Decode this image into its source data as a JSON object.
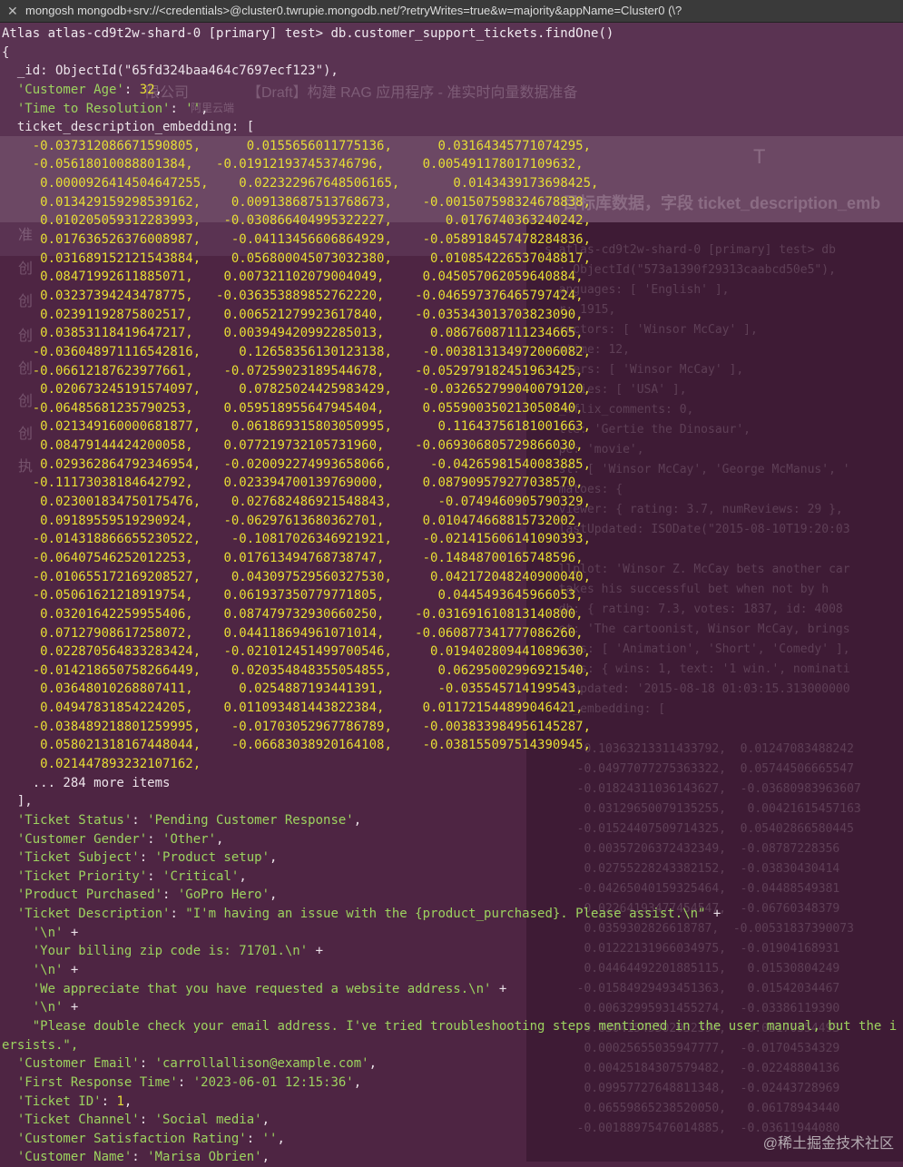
{
  "window": {
    "title": "mongosh mongodb+srv://<credentials>@cluster0.twrupie.mongodb.net/?retryWrites=true&w=majority&appName=Cluster0 (\\?"
  },
  "terminal": {
    "prompt": "Atlas atlas-cd9t2w-shard-0 [primary] test> ",
    "command": "db.customer_support_tickets.findOne()",
    "id_line": "  _id: ObjectId(\"65fd324baa464c7697ecf123\"),",
    "fields_top": [
      {
        "key": "'Customer Age'",
        "value": "32",
        "type": "n"
      },
      {
        "key": "'Time to Resolution'",
        "value": "''",
        "type": "s"
      }
    ],
    "embedding_key": "ticket_description_embedding",
    "embedding_rows": [
      [
        "-0.037312086671590805,",
        "0.0155656011775136,",
        "0.03164345771074295,"
      ],
      [
        "-0.05618010088801384,",
        "-0.019121937453746796,",
        "0.005491178017109632,"
      ],
      [
        "0.0000926414504647255,",
        "0.022322967648506165,",
        "0.0143439173698425,"
      ],
      [
        "0.013429159298539162,",
        "0.009138687513768673,",
        "-0.001507598324678838,"
      ],
      [
        "0.010205059312283993,",
        "-0.030866404995322227,",
        "0.0176740363240242,"
      ],
      [
        "0.017636526376008987,",
        "-0.04113456606864929,",
        "-0.058918457478284836,"
      ],
      [
        "0.031689152121543884,",
        "0.056800045073032380,",
        "0.010854226537048817,"
      ],
      [
        "0.08471992611885071,",
        "0.007321102079004049,",
        "0.045057062059640884,"
      ],
      [
        "0.03237394243478775,",
        "-0.036353889852762220,",
        "-0.046597376465797424,"
      ],
      [
        "0.02391192875802517,",
        "0.006521279923617840,",
        "-0.035343013703823090,"
      ],
      [
        "0.03853118419647217,",
        "0.003949420992285013,",
        "0.08676087111234665,"
      ],
      [
        "-0.036048971116542816,",
        "0.12658356130123138,",
        "-0.003813134972006082,"
      ],
      [
        "-0.06612187623977661,",
        "-0.07259023189544678,",
        "-0.052979182451963425,"
      ],
      [
        "0.020673245191574097,",
        "0.07825024425983429,",
        "-0.032652799040079120,"
      ],
      [
        "-0.06485681235790253,",
        "0.059518955647945404,",
        "0.055900350213050840,"
      ],
      [
        "0.021349160000681877,",
        "0.061869315803050995,",
        "0.11643756181001663,"
      ],
      [
        "0.08479144424200058,",
        "0.077219732105731960,",
        "-0.069306805729866030,"
      ],
      [
        "0.029362864792346954,",
        "-0.020092274993658066,",
        "-0.04265981540083885,"
      ],
      [
        "-0.11173038184642792,",
        "0.023394700139769000,",
        "0.087909579277038570,"
      ],
      [
        "0.023001834750175476,",
        "0.027682486921548843,",
        "-0.0749460905790329,"
      ],
      [
        "0.09189559519290924,",
        "-0.06297613680362701,",
        "0.010474668815732002,"
      ],
      [
        "-0.014318866655230522,",
        "-0.10817026346921921,",
        "-0.021415606141090393,"
      ],
      [
        "-0.06407546252012253,",
        "0.017613494768738747,",
        "-0.14848700165748596,"
      ],
      [
        "-0.010655172169208527,",
        "0.043097529560327530,",
        "0.042172048240900040,"
      ],
      [
        "-0.05061621218919754,",
        "0.061937350779771805,",
        "0.0445493645966053,"
      ],
      [
        "0.03201642259955406,",
        "0.087479732930660250,",
        "-0.031691610813140800,"
      ],
      [
        "0.07127908617258072,",
        "0.044118694961071014,",
        "-0.060877341777086260,"
      ],
      [
        "0.022870564833283424,",
        "-0.021012451499700546,",
        "0.019402809441089630,"
      ],
      [
        "-0.014218650758266449,",
        "0.020354848355054855,",
        "0.06295002996921540,"
      ],
      [
        "0.03648010268807411,",
        "0.0254887193441391,",
        "-0.035545714199543,"
      ],
      [
        "0.04947831854224205,",
        "0.011093481443822384,",
        "0.011721544899046421,"
      ],
      [
        "-0.038489218801259995,",
        "-0.01703052967786789,",
        "-0.003833984956145287,"
      ],
      [
        "0.058021318167448044,",
        "-0.06683038920164108,",
        "-0.038155097514390945,"
      ],
      [
        "0.021447893232107162,",
        "",
        ""
      ]
    ],
    "more_items": "... 284 more items",
    "fields_mid": [
      {
        "key": "'Ticket Status'",
        "value": "'Pending Customer Response'",
        "type": "s"
      },
      {
        "key": "'Customer Gender'",
        "value": "'Other'",
        "type": "s"
      },
      {
        "key": "'Ticket Subject'",
        "value": "'Product setup'",
        "type": "s"
      },
      {
        "key": "'Ticket Priority'",
        "value": "'Critical'",
        "type": "s"
      },
      {
        "key": "'Product Purchased'",
        "value": "'GoPro Hero'",
        "type": "s"
      }
    ],
    "description_key": "'Ticket Description'",
    "description_lines": [
      "\"I'm having an issue with the {product_purchased}. Please assist.\\n\"",
      "'\\n'",
      "'Your billing zip code is: 71701.\\n'",
      "'\\n'",
      "'We appreciate that you have requested a website address.\\n'",
      "'\\n'",
      "\"Please double check your email address. I've tried troubleshooting steps mentioned in the user manual, but the i"
    ],
    "description_wrap": "ersists.\",",
    "fields_bottom": [
      {
        "key": "'Customer Email'",
        "value": "'carrollallison@example.com'",
        "type": "s"
      },
      {
        "key": "'First Response Time'",
        "value": "'2023-06-01 12:15:36'",
        "type": "s"
      },
      {
        "key": "'Ticket ID'",
        "value": "1",
        "type": "n"
      },
      {
        "key": "'Ticket Channel'",
        "value": "'Social media'",
        "type": "s"
      },
      {
        "key": "'Customer Satisfaction Rating'",
        "value": "''",
        "type": "s"
      },
      {
        "key": "'Customer Name'",
        "value": "'Marisa Obrien'",
        "type": "s"
      }
    ]
  },
  "background": {
    "breadcrumb_company": "限公司",
    "doc_title": "【Draft】构建 RAG 应用程序 - 准实时向量数据准备",
    "subtitle": "阿里云端",
    "body_text": "目标库数据，字段 ticket_description_emb",
    "toolbar_t": "T",
    "nav_items": [
      "准",
      "创",
      "创",
      "创",
      "创",
      "创",
      "创",
      "执"
    ],
    "right_lines": [
      "s atlas-cd9t2w-shard-0 [primary] test> db",
      "  : ObjectId(\"573a1390f29313caabcd50e5\"),",
      "  anguages: [ 'English' ],",
      "  r: 1915,",
      "  rectors: [ 'Winsor McCay' ],",
      "  ntime: 12,",
      "  iters: [ 'Winsor McCay' ],",
      "  ntries: [ 'USA' ],",
      "  _mflix_comments: 0,",
      "  tle: 'Gertie the Dinosaur',",
      "  pe: 'movie',",
      "  st: [ 'Winsor McCay', 'George McManus', '",
      "  matoes: {",
      "  viewer: { rating: 3.7, numReviews: 29 },",
      "  lastUpdated: ISODate(\"2015-08-10T19:20:03",
      "",
      "  llplot: 'Winsor Z. McCay bets another car",
      "  takes his successful bet when not by h",
      "  db: { rating: 7.3, votes: 1837, id: 4008",
      "  ot: 'The cartoonist, Winsor McCay, brings",
      "  nres: [ 'Animation', 'Short', 'Comedy' ],",
      "  ards: { wins: 1, text: '1 win.', nominati",
      "  stupdated: '2015-08-18 01:03:15.313000000",
      "  ot_embedding: ["
    ],
    "right_numbers": [
      "  -0.10363213311433792,  0.01247083488242",
      "  -0.04977077275363322,  0.05744506665547",
      "  -0.01824311036143627,  -0.03680983963607",
      "   0.03129650079135255,   0.00421615457163",
      "  -0.01524407509714325,  0.05402866580445",
      "   0.00357206372432349,  -0.08787228356",
      "   0.02755228243382152,  -0.03830430414",
      "  -0.04265040159325464,  -0.04488549381",
      "  -0.02264193477454547,  -0.06760348379",
      "   0.0359302826618787,  -0.00531837390073",
      "   0.01222131966034975,  -0.01904168931",
      "   0.04464492201885115,   0.01530804249",
      "  -0.01584929493451363,   0.01542034467",
      "   0.00632995931455274,  -0.03386119390",
      "   0.03041545502032394,   0.03170354493",
      "   0.00025655035947777,  -0.01704534329",
      "   0.00425184307579482,  -0.02248804136",
      "   0.09957727648811348,  -0.02443728969",
      "   0.06559865238520050,   0.06178943440",
      "  -0.00188975476014885,  -0.03611944080"
    ]
  },
  "watermark": "@稀土掘金技术社区"
}
